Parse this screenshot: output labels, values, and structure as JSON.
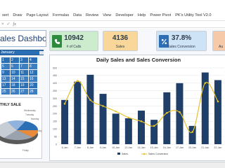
{
  "ribbon": {
    "tabs": [
      "sert",
      "Draw",
      "Page Layout",
      "Formulas",
      "Data",
      "Review",
      "View",
      "Developer",
      "Help",
      "Power Pivot",
      "PK's Utility Tool V2.0"
    ]
  },
  "formula_bar": {
    "cancel_symbol": "×",
    "confirm_symbol": "✓",
    "function_symbol": "fx"
  },
  "dashboard": {
    "title": "Sales Dashboard"
  },
  "kpis": [
    {
      "value": "10942",
      "label": "# of Calls",
      "icon": "phone-icon",
      "color": "#2e8b3e"
    },
    {
      "value": "4136",
      "label": "Sales",
      "icon": "cart-icon",
      "color": "#e08a12"
    },
    {
      "value": "37.8%",
      "label": "Sales Conversion",
      "icon": "percent-icon",
      "color": "#2f6db3"
    },
    {
      "value": "",
      "label": "Au",
      "icon": "",
      "color": "#f6c9a8"
    }
  ],
  "calendar": {
    "header": "January",
    "clear_icon": "filter-clear-icon",
    "cells": [
      "1",
      "2",
      "3",
      "4",
      "5",
      "6",
      "7",
      "8",
      "9",
      "10",
      "11",
      "12",
      "13",
      "14",
      "15",
      "16",
      "17",
      "18",
      "19",
      "20",
      "25",
      "26",
      "27",
      "28"
    ]
  },
  "pie_panel": {
    "title": "THLY SALE",
    "slice_labels": [
      "Wednesday",
      "Tuesday",
      "Monday",
      "Thursday",
      "Friday"
    ]
  },
  "colors": {
    "bar": "#1f3e68",
    "line": "#e6c229",
    "title_text": "#1e3f73",
    "calendar": "#2b6fb5"
  },
  "chart_data": {
    "type": "bar",
    "title": "Daily Sales and Sales Conversion",
    "xlabel": "",
    "ylabel": "",
    "ylim": [
      0,
      500
    ],
    "y_ticks": [
      "0",
      "50",
      "100",
      "150",
      "200",
      "250",
      "300",
      "350",
      "400",
      "450",
      "500"
    ],
    "categories": [
      "6-Jan",
      "7-Jan",
      "8-Jan",
      "9-Jan",
      "10-Jan",
      "13-Jan",
      "14-Jan",
      "15-Jan",
      "16-Jan",
      "17-Jan",
      "20-Jan",
      "21-Jan",
      "22-Jan"
    ],
    "series": [
      {
        "name": "Sales",
        "type": "bar",
        "values": [
          290,
          410,
          455,
          330,
          200,
          170,
          220,
          160,
          340,
          400,
          120,
          470,
          420
        ]
      },
      {
        "name": "Sales Conversion",
        "type": "line",
        "values": [
          265,
          415,
          290,
          250,
          215,
          175,
          150,
          120,
          205,
          210,
          80,
          400,
          280
        ]
      }
    ],
    "legend": "bottom",
    "grid": true
  }
}
